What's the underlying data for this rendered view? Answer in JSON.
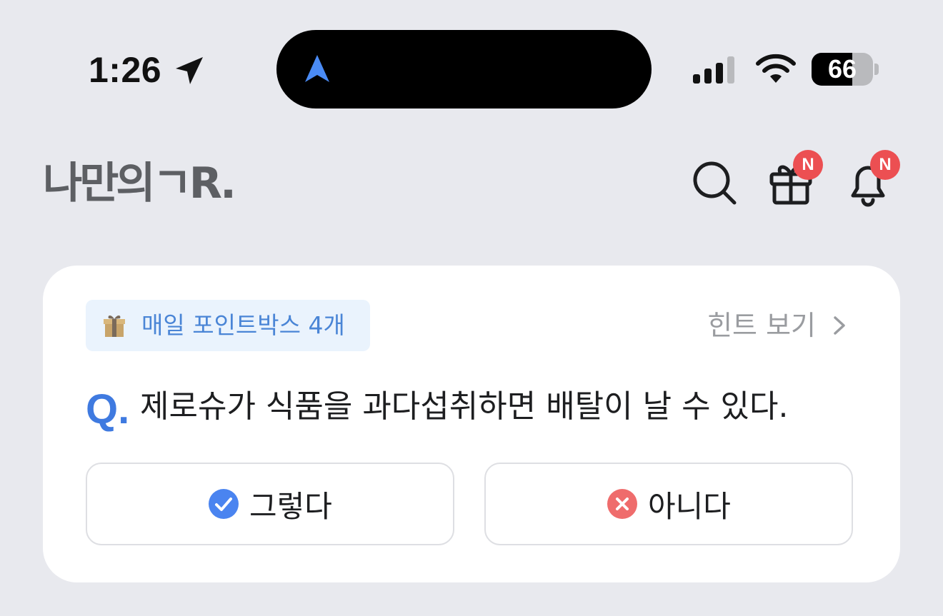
{
  "status_bar": {
    "time": "1:26",
    "battery_level": "66",
    "battery_fraction": 0.66
  },
  "header": {
    "logo_text": "나만의ㄱR.",
    "gift_badge": "N",
    "bell_badge": "N"
  },
  "quiz_card": {
    "point_chip_label": "매일 포인트박스 4개",
    "hint_label": "힌트 보기",
    "question_prefix": "Q.",
    "question_text": "제로슈가 식품을 과다섭취하면 배탈이 날 수 있다.",
    "answers": [
      {
        "label": "그렇다",
        "icon": "check-circle-icon",
        "color": "#4a84f0"
      },
      {
        "label": "아니다",
        "icon": "x-circle-icon",
        "color": "#ef6c6c"
      }
    ]
  },
  "colors": {
    "background": "#e8e9ee",
    "accent_blue": "#3f7ae0",
    "badge_red": "#ec4f52"
  }
}
